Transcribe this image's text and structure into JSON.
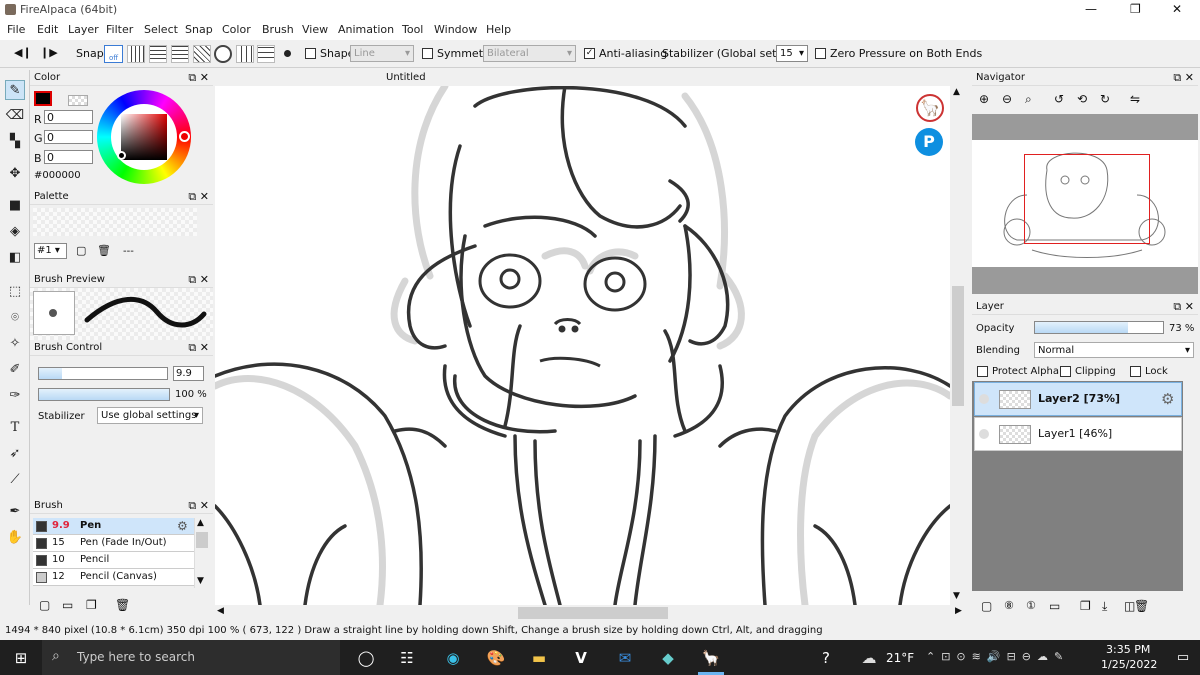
{
  "window": {
    "title": "FireAlpaca (64bit)",
    "controls": [
      "—",
      "❐",
      "✕"
    ]
  },
  "menu": [
    "File",
    "Edit",
    "Layer",
    "Filter",
    "Select",
    "Snap",
    "Color",
    "Brush",
    "View",
    "Animation",
    "Tool",
    "Window",
    "Help"
  ],
  "toolbar": {
    "snap_label": "Snap",
    "snap_off": "off",
    "shape_label": "Shape",
    "shape_value": "Line",
    "symmetry_label": "Symmetry",
    "symmetry_value": "Bilateral",
    "antialias_label": "Anti-aliasing",
    "antialias_checked": true,
    "stabilizer_label": "Stabilizer (Global settings)",
    "stabilizer_value": "15",
    "zero_pressure_label": "Zero Pressure on Both Ends"
  },
  "color_panel": {
    "title": "Color",
    "r_label": "R",
    "g_label": "G",
    "b_label": "B",
    "r": "0",
    "g": "0",
    "b": "0",
    "hex": "#000000"
  },
  "palette_panel": {
    "title": "Palette",
    "index": "#1",
    "sep": "---"
  },
  "brush_preview": {
    "title": "Brush Preview"
  },
  "brush_control": {
    "title": "Brush Control",
    "size": "9.9",
    "opacity": "100 %",
    "stabilizer_label": "Stabilizer",
    "stabilizer_value": "Use global settings",
    "size_fraction": 0.18,
    "opacity_fraction": 1.0
  },
  "brush_panel": {
    "title": "Brush",
    "items": [
      {
        "size": "9.9",
        "name": "Pen",
        "selected": true
      },
      {
        "size": "15",
        "name": "Pen (Fade In/Out)",
        "selected": false
      },
      {
        "size": "10",
        "name": "Pencil",
        "selected": false
      },
      {
        "size": "12",
        "name": "Pencil (Canvas)",
        "selected": false
      }
    ]
  },
  "canvas": {
    "tab_title": "Untitled"
  },
  "navigator": {
    "title": "Navigator"
  },
  "layer_panel": {
    "title": "Layer",
    "opacity_label": "Opacity",
    "opacity_value": "73 %",
    "opacity_fraction": 0.73,
    "blending_label": "Blending",
    "blending_value": "Normal",
    "protect_alpha": "Protect Alpha",
    "clipping": "Clipping",
    "lock": "Lock",
    "layers": [
      {
        "name": "Layer2 [73%]",
        "selected": true
      },
      {
        "name": "Layer1 [46%]",
        "selected": false
      }
    ]
  },
  "status": {
    "text": "1494 * 840 pixel   (10.8 * 6.1cm)   350 dpi   100 %   ( 673, 122 )   Draw a straight line by holding down Shift, Change a brush size by holding down Ctrl, Alt, and dragging"
  },
  "taskbar": {
    "search_placeholder": "Type here to search",
    "weather": "21°F",
    "time": "3:35 PM",
    "date": "1/25/2022"
  },
  "colors": {
    "accent": "#cce4f7",
    "selected_row": "#cfe5fa",
    "brush_red": "#e0243c",
    "taskbar": "#1f1f1f"
  }
}
